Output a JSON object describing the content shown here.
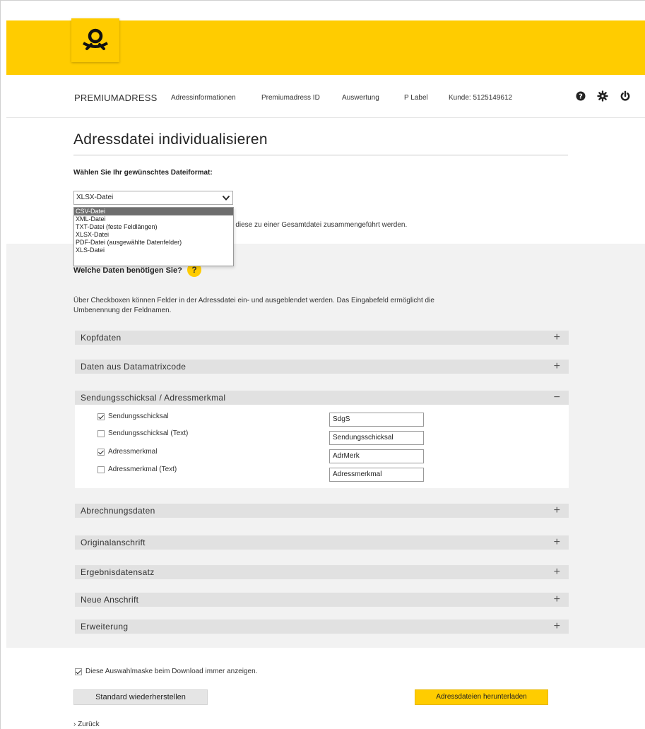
{
  "nav": {
    "brand": "PREMIUMADRESS",
    "items": [
      "Adressinformationen",
      "Premiumadress ID",
      "Auswertung",
      "P Label",
      "Kunde: 5125149612"
    ]
  },
  "page": {
    "title": "Adressdatei individualisieren",
    "format_label": "Wählen Sie Ihr gewünschtes Dateiformat:",
    "selected_format": "XLSX-Datei",
    "format_options": [
      "CSV-Datei",
      "XML-Datei",
      "TXT-Datei (feste Feldlängen)",
      "XLSX-Datei",
      "PDF-Datei (ausgewählte Datenfelder)",
      "XLS-Datei"
    ],
    "merge_text": "n diese zu einer Gesamtdatei zusammengeführt werden.",
    "which_data_label": "Welche Daten benötigen Sie?",
    "help_glyph": "?",
    "description": "Über Checkboxen können Felder in der Adressdatei ein- und ausgeblendet werden. Das Eingabefeld ermöglicht die Umbenennung der Feldnamen."
  },
  "accordion": [
    {
      "title": "Kopfdaten",
      "sign": "+"
    },
    {
      "title": "Daten aus Datamatrixcode",
      "sign": "+"
    },
    {
      "title": "Sendungsschicksal / Adressmerkmal",
      "sign": "−"
    },
    {
      "title": "Abrechnungsdaten",
      "sign": "+"
    },
    {
      "title": "Originalanschrift",
      "sign": "+"
    },
    {
      "title": "Ergebnisdatensatz",
      "sign": "+"
    },
    {
      "title": "Neue Anschrift",
      "sign": "+"
    },
    {
      "title": "Erweiterung",
      "sign": "+"
    }
  ],
  "fields": [
    {
      "label": "Sendungsschicksal",
      "checked": true,
      "value": "SdgS"
    },
    {
      "label": "Sendungsschicksal (Text)",
      "checked": false,
      "value": "Sendungsschicksal"
    },
    {
      "label": "Adressmerkmal",
      "checked": true,
      "value": "AdrMerk"
    },
    {
      "label": "Adressmerkmal (Text)",
      "checked": false,
      "value": "Adressmerkmal"
    }
  ],
  "footer": {
    "always_show_label": "Diese Auswahlmaske beim Download immer anzeigen.",
    "always_show_checked": true,
    "reset_button": "Standard wiederherstellen",
    "download_button": "Adressdateien herunterladen",
    "back_link": "› Zurück"
  },
  "colors": {
    "brand_yellow": "#ffcc00",
    "band_gray": "#f2f2f2",
    "accordion_gray": "#e1e1e1"
  },
  "icons": [
    "post-horn-icon",
    "help-icon",
    "gear-icon",
    "power-icon",
    "chevron-down-icon"
  ]
}
